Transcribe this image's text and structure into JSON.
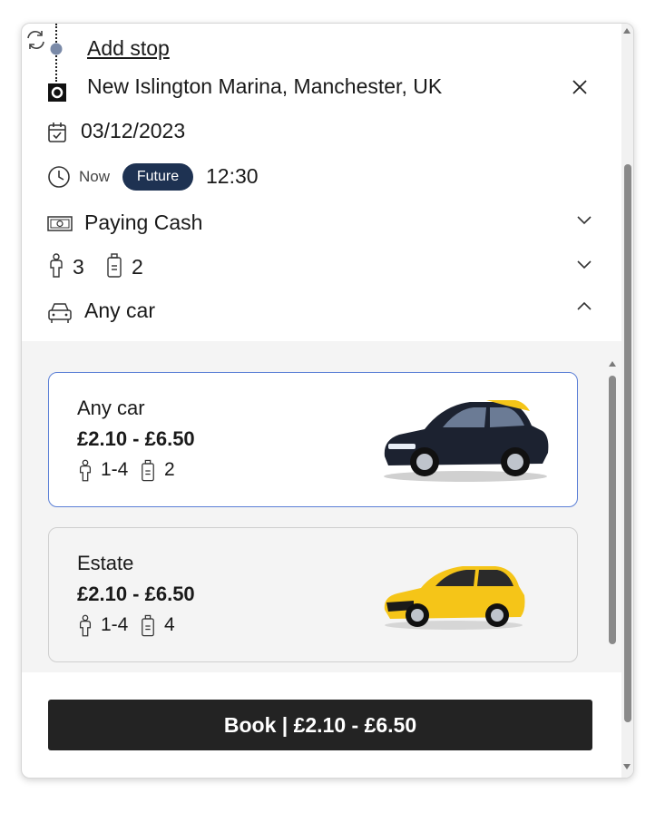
{
  "route": {
    "add_stop_label": "Add stop",
    "destination": "New Islington Marina, Manchester, UK"
  },
  "date": {
    "value": "03/12/2023"
  },
  "time": {
    "now_label": "Now",
    "future_label": "Future",
    "value": "12:30"
  },
  "payment": {
    "label": "Paying Cash"
  },
  "capacity": {
    "passengers": "3",
    "luggage": "2"
  },
  "car_type": {
    "label": "Any car"
  },
  "cars": [
    {
      "name": "Any car",
      "price": "£2.10 - £6.50",
      "passengers": "1-4",
      "luggage": "2",
      "color": "#1c2230",
      "accent": "#f5c518"
    },
    {
      "name": "Estate",
      "price": "£2.10 - £6.50",
      "passengers": "1-4",
      "luggage": "4",
      "color": "#f5c518",
      "accent": "#1a1a1a"
    }
  ],
  "book": {
    "label": "Book | £2.10 - £6.50"
  },
  "colors": {
    "selected_border": "#5b7fd6",
    "pill_bg": "#1e3252",
    "book_bg": "#232323"
  },
  "icons": [
    "swap-icon",
    "stop-dot-icon",
    "destination-pin-icon",
    "close-icon",
    "calendar-icon",
    "clock-icon",
    "cash-icon",
    "passenger-icon",
    "luggage-icon",
    "chevron-down-icon",
    "chevron-up-icon",
    "car-outline-icon"
  ]
}
